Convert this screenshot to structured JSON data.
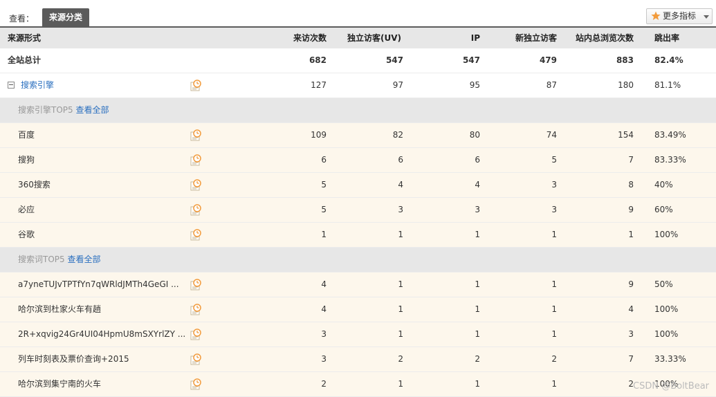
{
  "toolbar": {
    "view_label": "查看：",
    "active_tab": "来源分类",
    "more_metrics": "更多指标"
  },
  "columns": {
    "source": "来源形式",
    "visits": "来访次数",
    "uv": "独立访客(UV)",
    "ip": "IP",
    "new_uv": "新独立访客",
    "pv": "站内总浏览次数",
    "bounce": "跳出率"
  },
  "total": {
    "name": "全站总计",
    "visits": "682",
    "uv": "547",
    "ip": "547",
    "new_uv": "479",
    "pv": "883",
    "bounce": "82.4%"
  },
  "engine": {
    "name": "搜索引擎",
    "visits": "127",
    "uv": "97",
    "ip": "95",
    "new_uv": "87",
    "pv": "180",
    "bounce": "81.1%"
  },
  "engine_group": {
    "label": "搜索引擎TOP5",
    "link": "查看全部"
  },
  "engines": [
    {
      "name": "百度",
      "visits": "109",
      "uv": "82",
      "ip": "80",
      "new_uv": "74",
      "pv": "154",
      "bounce": "83.49%"
    },
    {
      "name": "搜狗",
      "visits": "6",
      "uv": "6",
      "ip": "6",
      "new_uv": "5",
      "pv": "7",
      "bounce": "83.33%"
    },
    {
      "name": "360搜索",
      "visits": "5",
      "uv": "4",
      "ip": "4",
      "new_uv": "3",
      "pv": "8",
      "bounce": "40%"
    },
    {
      "name": "必应",
      "visits": "5",
      "uv": "3",
      "ip": "3",
      "new_uv": "3",
      "pv": "9",
      "bounce": "60%"
    },
    {
      "name": "谷歌",
      "visits": "1",
      "uv": "1",
      "ip": "1",
      "new_uv": "1",
      "pv": "1",
      "bounce": "100%"
    }
  ],
  "keyword_group": {
    "label": "搜索词TOP5",
    "link": "查看全部"
  },
  "keywords": [
    {
      "name": "a7yneTUJvTPTfYn7qWRldJMTh4GeGI ...",
      "visits": "4",
      "uv": "1",
      "ip": "1",
      "new_uv": "1",
      "pv": "9",
      "bounce": "50%"
    },
    {
      "name": "哈尔滨到杜家火车有趟",
      "visits": "4",
      "uv": "1",
      "ip": "1",
      "new_uv": "1",
      "pv": "4",
      "bounce": "100%"
    },
    {
      "name": "2R+xqvig24Gr4UI04HpmU8mSXYrlZY ...",
      "visits": "3",
      "uv": "1",
      "ip": "1",
      "new_uv": "1",
      "pv": "3",
      "bounce": "100%"
    },
    {
      "name": "列车时刻表及票价查询+2015",
      "visits": "3",
      "uv": "2",
      "ip": "2",
      "new_uv": "2",
      "pv": "7",
      "bounce": "33.33%"
    },
    {
      "name": "哈尔滨到集宁南的火车",
      "visits": "2",
      "uv": "1",
      "ip": "1",
      "new_uv": "1",
      "pv": "2",
      "bounce": "100%"
    }
  ],
  "watermark": "CSDN @BoltBear",
  "colors": {
    "tab_bg": "#5b5b5b",
    "link": "#2a6fbf",
    "child_row_bg": "#fdf7ec",
    "group_row_bg": "#e7e7e7",
    "icon_orange": "#f29b3c"
  }
}
